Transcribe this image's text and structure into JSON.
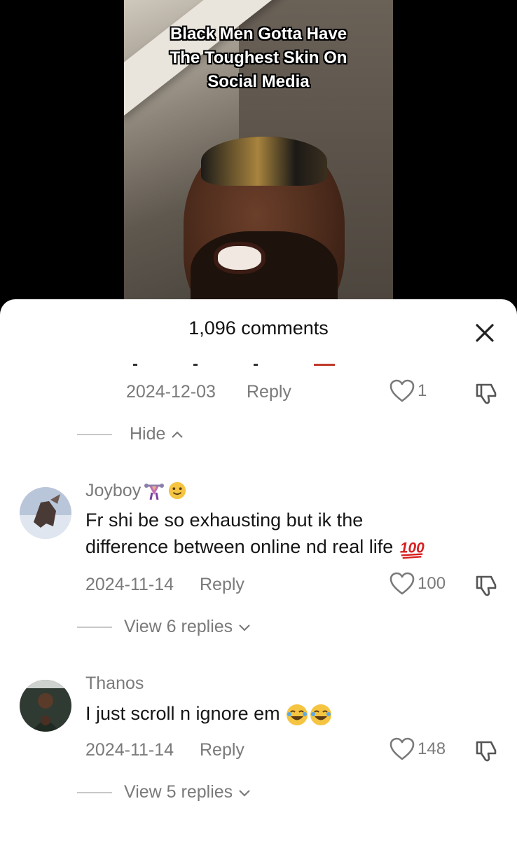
{
  "video": {
    "caption_lines": [
      "Black Men Gotta Have",
      "The Toughest Skin On",
      "Social Media"
    ]
  },
  "sheet": {
    "title": "1,096 comments",
    "close_icon": "close-icon"
  },
  "partial_comment": {
    "date": "2024-12-03",
    "reply_label": "Reply",
    "likes": "1",
    "hide_label": "Hide"
  },
  "comments": [
    {
      "username": "Joyboy",
      "username_emojis": [
        "weightlifter-emoji",
        "smiling-face-emoji"
      ],
      "text_line1": "Fr shi be so exhausting but ik the",
      "text_line2": "difference between online nd real life",
      "text_emoji": "hundred-points-emoji",
      "date": "2024-11-14",
      "reply_label": "Reply",
      "likes": "100",
      "replies_label": "View 6 replies"
    },
    {
      "username": "Thanos",
      "text": "I just scroll n ignore em",
      "text_emojis": [
        "tears-of-joy-emoji",
        "tears-of-joy-emoji"
      ],
      "date": "2024-11-14",
      "reply_label": "Reply",
      "likes": "148",
      "replies_label": "View 5 replies"
    }
  ],
  "colors": {
    "sheet_bg": "#ffffff",
    "muted_text": "#7a7a7a",
    "primary_text": "#161616",
    "hundred_red": "#d81e1e",
    "emoji_yellow": "#f5c542"
  }
}
